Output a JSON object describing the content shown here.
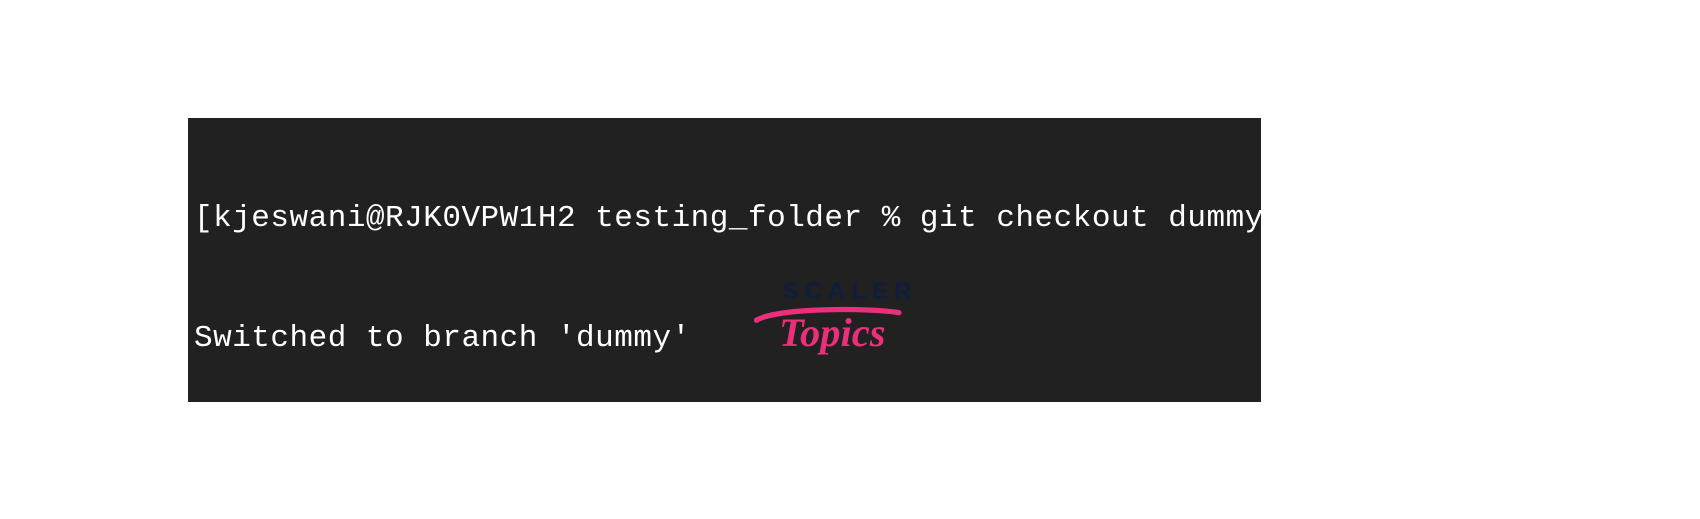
{
  "terminal": {
    "lines": [
      "[kjeswani@RJK0VPW1H2 testing_folder % git checkout dummy",
      "Switched to branch 'dummy'"
    ]
  },
  "logo": {
    "primary": "SCALER",
    "secondary": "Topics"
  }
}
